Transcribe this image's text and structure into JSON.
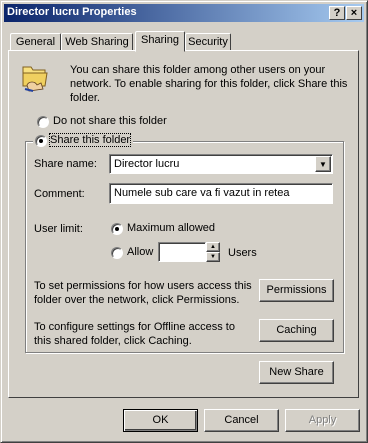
{
  "window": {
    "title": "Director lucru Properties",
    "help_label": "?",
    "close_label": "×"
  },
  "tabs": [
    {
      "label": "General"
    },
    {
      "label": "Web Sharing"
    },
    {
      "label": "Sharing"
    },
    {
      "label": "Security"
    }
  ],
  "sharing": {
    "info_text_1": "You can share this folder among other users on your",
    "info_text_2": "network. To enable sharing for this folder, click Share this",
    "info_text_3": "folder.",
    "do_not_share_label": "Do not share this folder",
    "share_label": "Share this folder",
    "share_name_label": "Share name:",
    "share_name_value": "Director lucru",
    "comment_label": "Comment:",
    "comment_value": "Numele sub care va fi vazut in retea",
    "user_limit_label": "User limit:",
    "maximum_allowed_label": "Maximum allowed",
    "allow_label": "Allow",
    "allow_value": "",
    "users_label": "Users",
    "permissions_text_1": "To set permissions for how users access this",
    "permissions_text_2": "folder over the network, click Permissions.",
    "permissions_button": "Permissions",
    "caching_text_1": "To configure settings for Offline access to",
    "caching_text_2": "this shared folder, click Caching.",
    "caching_button": "Caching",
    "new_share_button": "New Share"
  },
  "footer": {
    "ok": "OK",
    "cancel": "Cancel",
    "apply": "Apply"
  },
  "colors": {
    "title_gradient_start": "#0a246a",
    "title_gradient_end": "#a6caf0",
    "face": "#d4d0c8"
  }
}
